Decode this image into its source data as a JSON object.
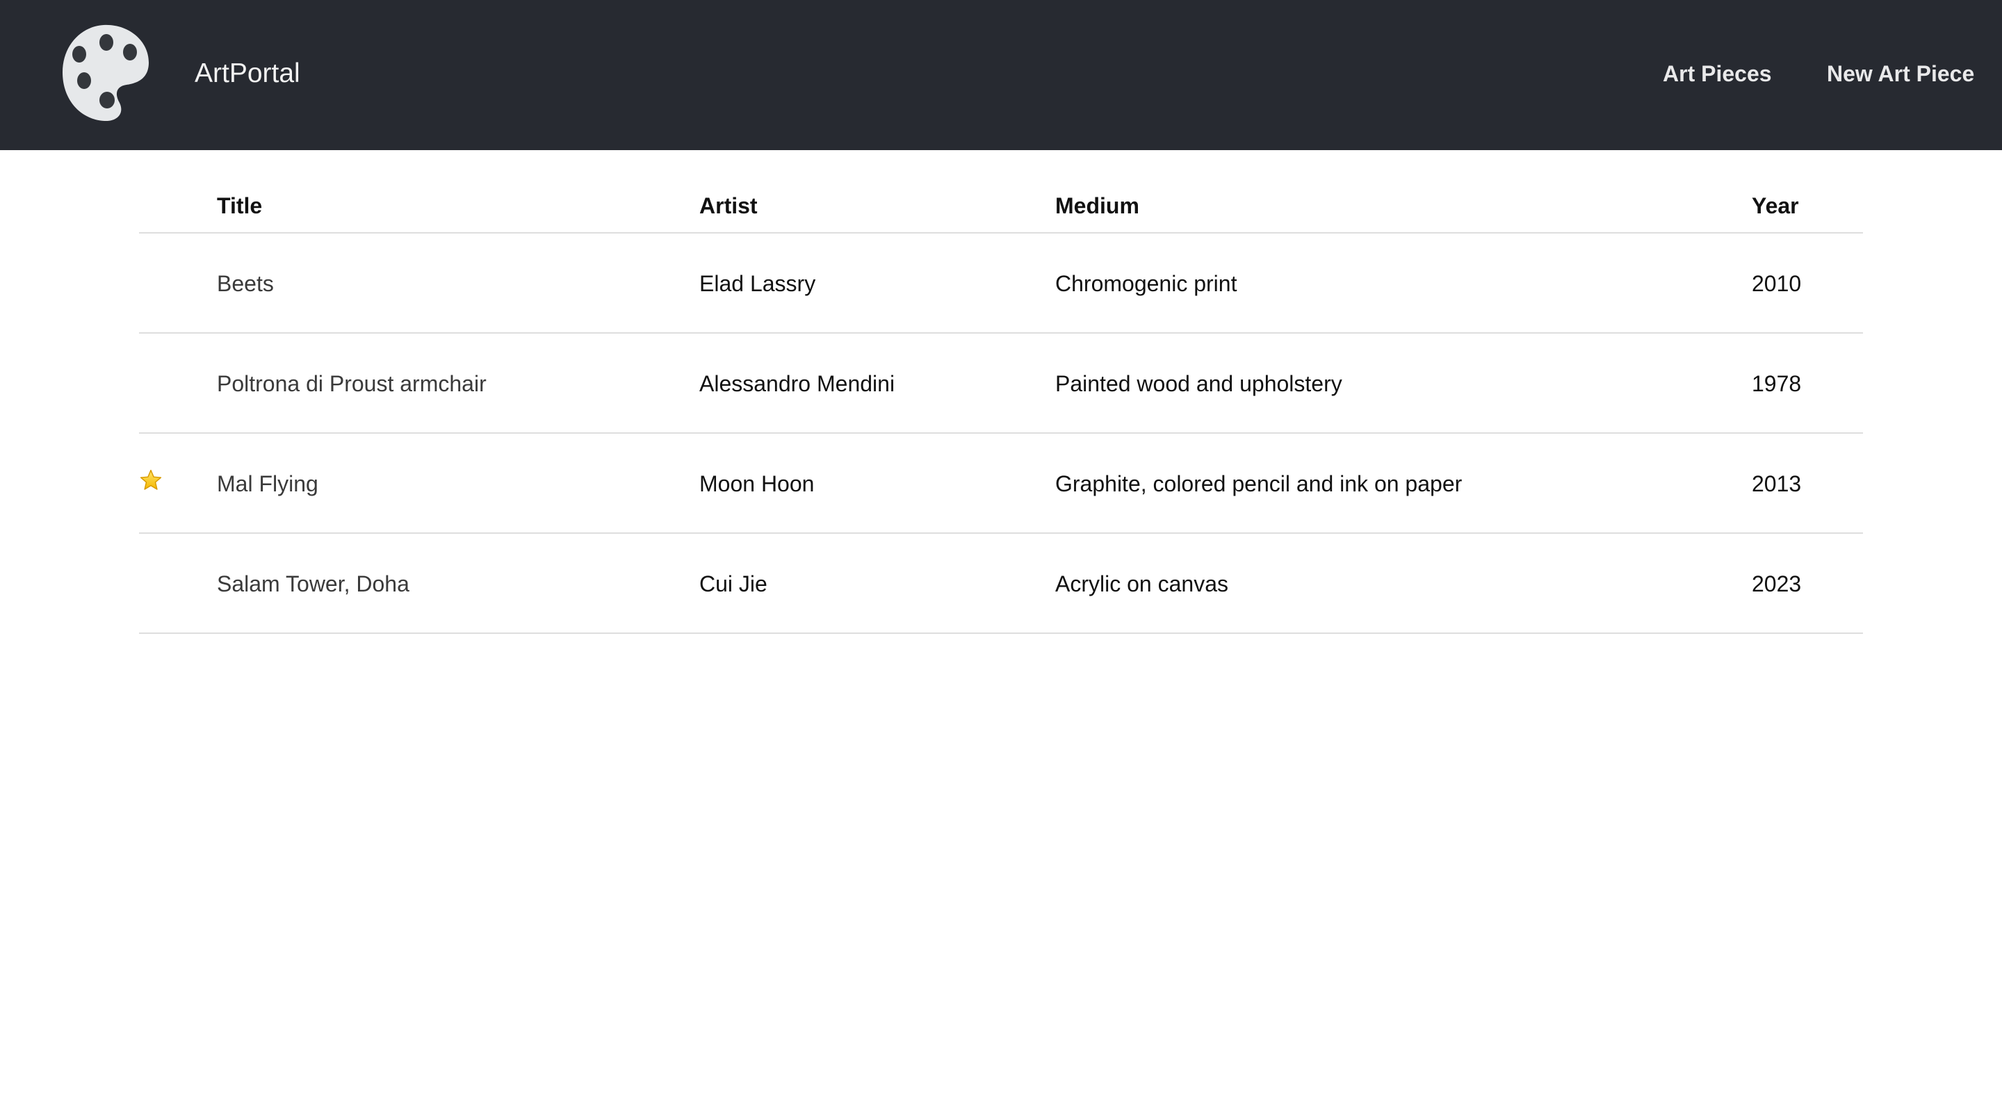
{
  "navbar": {
    "logo_icon": "palette-icon",
    "brand": "ArtPortal",
    "links": [
      {
        "label": "Art Pieces"
      },
      {
        "label": "New Art Piece"
      }
    ],
    "colors": {
      "background": "#272a31",
      "text": "#f2f2f2"
    }
  },
  "table": {
    "headers": {
      "title": "Title",
      "artist": "Artist",
      "medium": "Medium",
      "year": "Year"
    },
    "rows": [
      {
        "favorite": false,
        "title": "Beets",
        "artist": "Elad Lassry",
        "medium": "Chromogenic print",
        "year": "2010"
      },
      {
        "favorite": false,
        "title": "Poltrona di Proust armchair",
        "artist": "Alessandro Mendini",
        "medium": "Painted wood and upholstery",
        "year": "1978"
      },
      {
        "favorite": true,
        "title": "Mal Flying",
        "artist": "Moon Hoon",
        "medium": "Graphite, colored pencil and ink on paper",
        "year": "2013"
      },
      {
        "favorite": false,
        "title": "Salam Tower, Doha",
        "artist": "Cui Jie",
        "medium": "Acrylic on canvas",
        "year": "2023"
      }
    ],
    "favorite_icon": "star-icon",
    "colors": {
      "star": "#f5c518",
      "divider": "#dedede"
    }
  }
}
